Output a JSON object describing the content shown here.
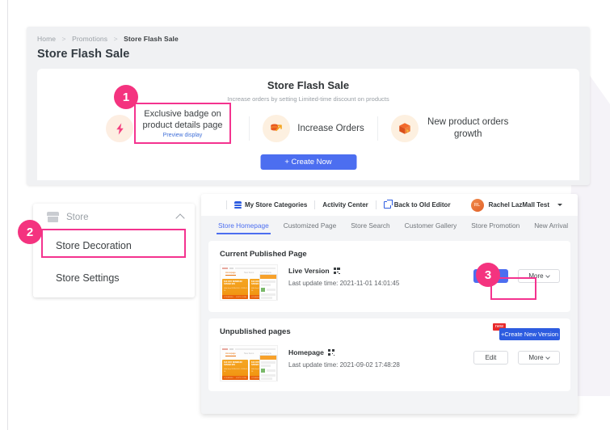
{
  "breadcrumb": {
    "home": "Home",
    "promotions": "Promotions",
    "current": "Store Flash Sale",
    "sep": ">"
  },
  "page": {
    "title": "Store Flash Sale"
  },
  "promo": {
    "title": "Store Flash Sale",
    "subtitle": "Increase orders by setting Limited-time discount on products",
    "features": [
      {
        "icon": "lightning-bolt-icon",
        "label": "Exclusive badge on product details page"
      },
      {
        "icon": "coins-arrow-icon",
        "label": "Increase Orders"
      },
      {
        "icon": "package-box-icon",
        "label": "New product orders growth"
      }
    ],
    "create_button": "+ Create Now"
  },
  "callout1": {
    "number": "1",
    "line1": "Exclusive badge on",
    "line2": "product details page",
    "link": "Preview display"
  },
  "sidebar": {
    "number": "2",
    "header": {
      "label": "Store",
      "icon": "store-icon",
      "chevron": "chevron-up-icon"
    },
    "items": [
      {
        "label": "Store Decoration",
        "selected": true
      },
      {
        "label": "Store Settings",
        "selected": false
      }
    ]
  },
  "topbar": {
    "my_store_categories": "My Store Categories",
    "activity_center": "Activity Center",
    "back_to_old_editor": "Back to Old Editor",
    "account": "Rachel LazMall Test",
    "avatar_initials": "RL"
  },
  "tabs": [
    {
      "label": "Store Homepage",
      "active": true
    },
    {
      "label": "Customized Page",
      "active": false
    },
    {
      "label": "Store Search",
      "active": false
    },
    {
      "label": "Customer Gallery",
      "active": false
    },
    {
      "label": "Store Promotion",
      "active": false
    },
    {
      "label": "New Arrival",
      "active": false
    }
  ],
  "published": {
    "section_title": "Current Published Page",
    "name": "Live Version",
    "update_time": "Last update time: 2021-11-01 14:01:45",
    "edit_button": "Edit",
    "more_button": "More",
    "callout_number": "3"
  },
  "unpublished": {
    "section_title": "Unpublished pages",
    "name": "Homepage",
    "update_time": "Last update time: 2021-09-02 17:48:28",
    "edit_button": "Edit",
    "more_button": "More",
    "create_version_button": "+Create New Version",
    "new_badge": "new"
  },
  "thumbnail": {
    "tab1": "Homepage",
    "tab2": "New Items",
    "tab3": "All Products",
    "card_title": "$13 OFF MINIMUM SPEND $50",
    "card_small": "Valid from 2018-01-10 - 2018-01-16",
    "card_code": "CODE8X50",
    "card_action": "COPY CODE"
  },
  "colors": {
    "accent_pink": "#f4337f",
    "primary_blue": "#4c6ef0",
    "link_blue": "#2d5ce0",
    "badge_red": "#e8292b",
    "orange": "#f0920f"
  }
}
